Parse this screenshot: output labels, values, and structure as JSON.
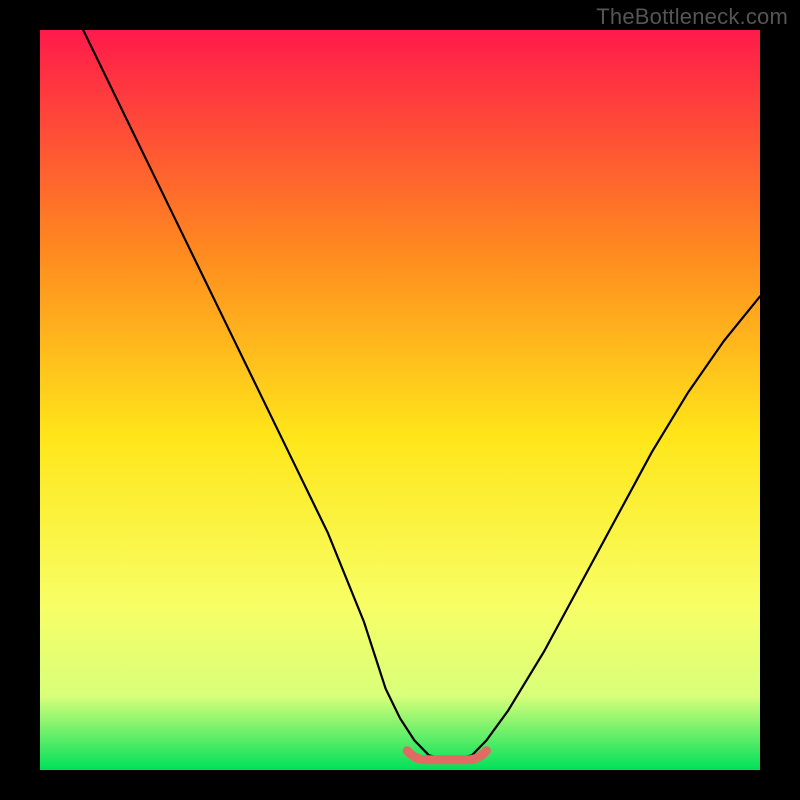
{
  "watermark": "TheBottleneck.com",
  "colors": {
    "gradient_top": "#ff1a4b",
    "gradient_upper_mid": "#ff8a1f",
    "gradient_mid": "#ffe61a",
    "gradient_lower_mid": "#f7ff66",
    "gradient_low": "#d8ff7a",
    "gradient_bottom": "#00e05a",
    "curve": "#000000",
    "bottom_mark": "#e16a63",
    "frame": "#000000"
  },
  "chart_data": {
    "type": "line",
    "title": "",
    "xlabel": "",
    "ylabel": "",
    "xlim": [
      0,
      100
    ],
    "ylim": [
      0,
      100
    ],
    "grid": false,
    "legend": false,
    "series": [
      {
        "name": "bottleneck-curve",
        "x": [
          6,
          10,
          15,
          20,
          25,
          30,
          35,
          40,
          45,
          48,
          50,
          52,
          54,
          56,
          58,
          60,
          62,
          65,
          70,
          75,
          80,
          85,
          90,
          95,
          100
        ],
        "y": [
          100,
          92,
          82,
          72,
          62,
          52,
          42,
          32,
          20,
          11,
          7,
          4,
          2,
          1.5,
          1.5,
          2,
          4,
          8,
          16,
          25,
          34,
          43,
          51,
          58,
          64
        ]
      }
    ],
    "flat_bottom": {
      "name": "optimal-range-marker",
      "x_start": 51,
      "x_end": 62,
      "y": 1.8
    }
  }
}
